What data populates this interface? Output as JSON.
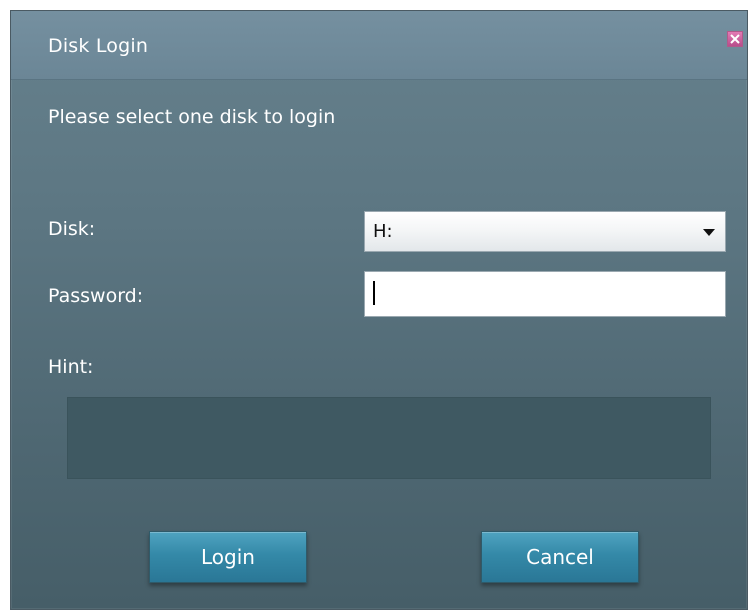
{
  "dialog": {
    "title": "Disk Login",
    "close_icon": "close-icon",
    "instruction": "Please select one disk to login",
    "disk": {
      "label": "Disk:",
      "selected": "H:",
      "icon": "dropdown-arrow-icon"
    },
    "password": {
      "label": "Password:",
      "value": "",
      "placeholder": ""
    },
    "hint": {
      "label": "Hint:",
      "text": ""
    },
    "buttons": {
      "login": "Login",
      "cancel": "Cancel"
    },
    "colors": {
      "dialog_bg": "#5c7682",
      "titlebar_bg": "#7590a0",
      "button_bg": "#3489a8",
      "close_button": "#d66aa6"
    }
  }
}
